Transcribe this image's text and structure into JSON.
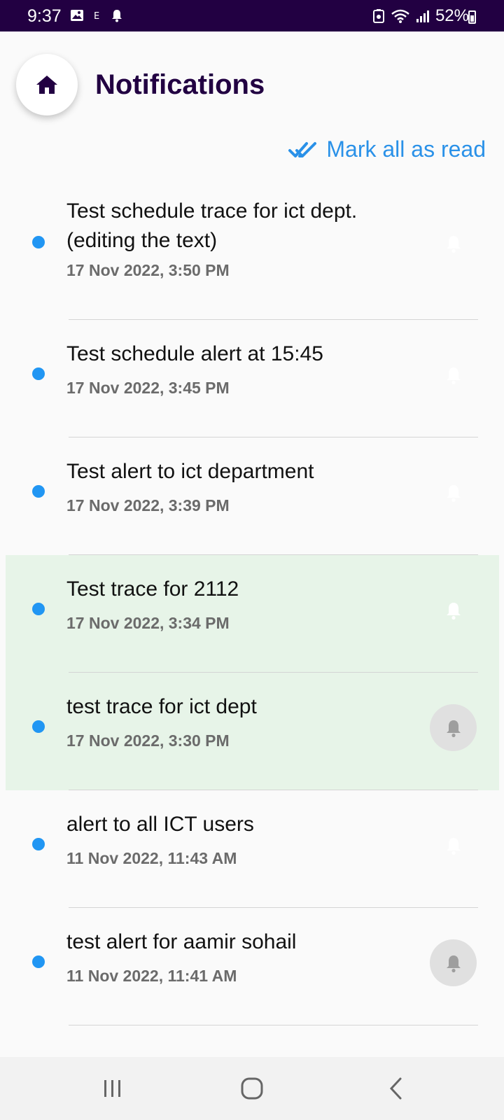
{
  "status_bar": {
    "time": "9:37",
    "battery": "52%"
  },
  "header": {
    "title": "Notifications",
    "home_icon": "home-icon"
  },
  "mark_all_label": "Mark all as read",
  "colors": {
    "accent": "#2196f3",
    "title": "#220042",
    "highlight": "#e7f4e8",
    "statusbar": "#220042"
  },
  "notifications": [
    {
      "title": "Test schedule trace for ict dept. (editing the text)",
      "time": "17 Nov 2022, 3:50 PM",
      "highlighted": true,
      "bell_active": true
    },
    {
      "title": "Test schedule alert at 15:45",
      "time": "17 Nov 2022, 3:45 PM",
      "highlighted": false,
      "bell_active": true
    },
    {
      "title": "Test alert to ict department",
      "time": "17 Nov 2022, 3:39 PM",
      "highlighted": false,
      "bell_active": true
    },
    {
      "title": "Test trace for 2112",
      "time": "17 Nov 2022, 3:34 PM",
      "highlighted": true,
      "bell_active": true
    },
    {
      "title": "test trace for ict dept",
      "time": "17 Nov 2022, 3:30 PM",
      "highlighted": true,
      "bell_active": false
    },
    {
      "title": "alert to all ICT users",
      "time": "11 Nov 2022, 11:43 AM",
      "highlighted": false,
      "bell_active": true
    },
    {
      "title": "test alert for aamir sohail",
      "time": "11 Nov 2022, 11:41 AM",
      "highlighted": false,
      "bell_active": false
    }
  ]
}
